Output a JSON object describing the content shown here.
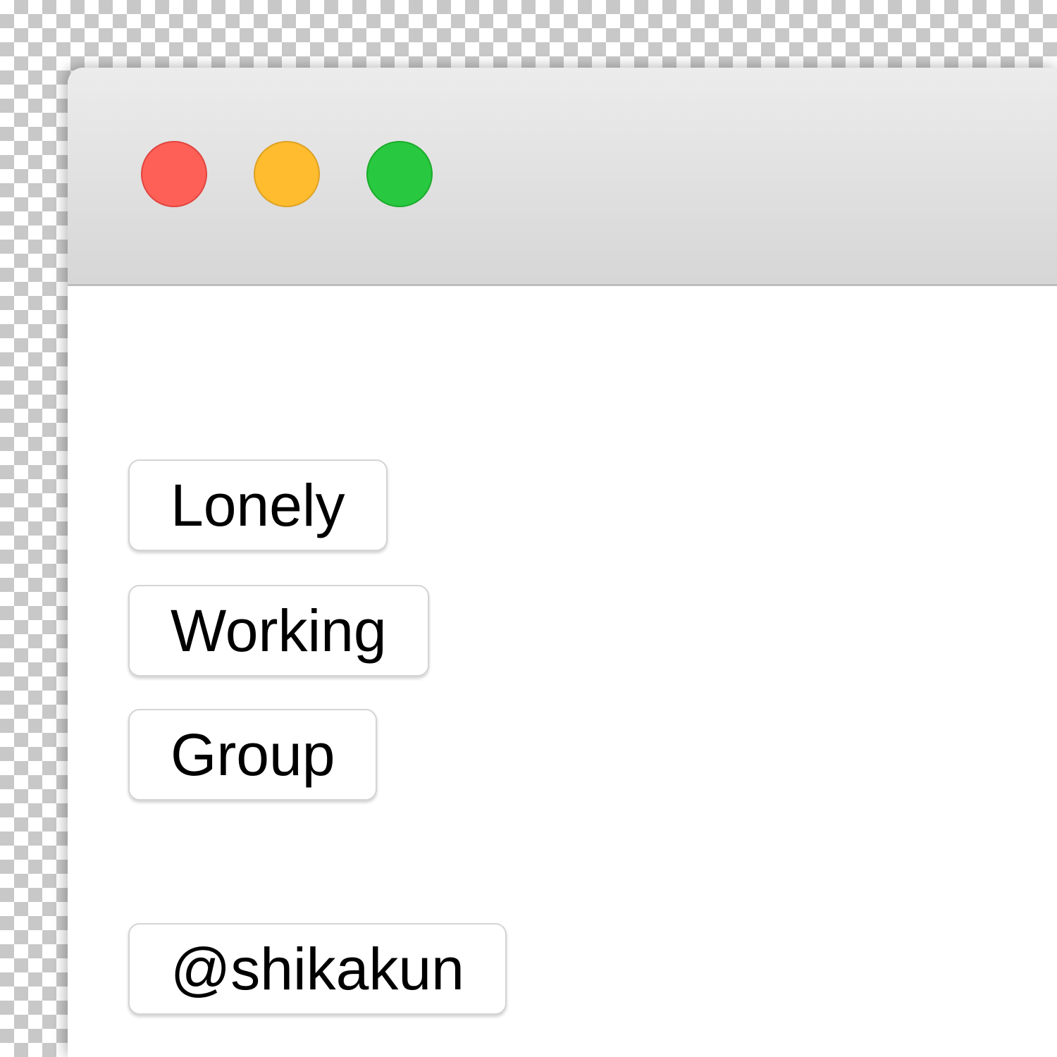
{
  "window": {
    "traffic_lights": [
      {
        "name": "close",
        "color": "#fe5f57"
      },
      {
        "name": "minimize",
        "color": "#febc2e"
      },
      {
        "name": "zoom",
        "color": "#28c840"
      }
    ]
  },
  "buttons": {
    "lonely": "Lonely",
    "working": "Working",
    "group": "Group",
    "handle": "@shikakun"
  }
}
